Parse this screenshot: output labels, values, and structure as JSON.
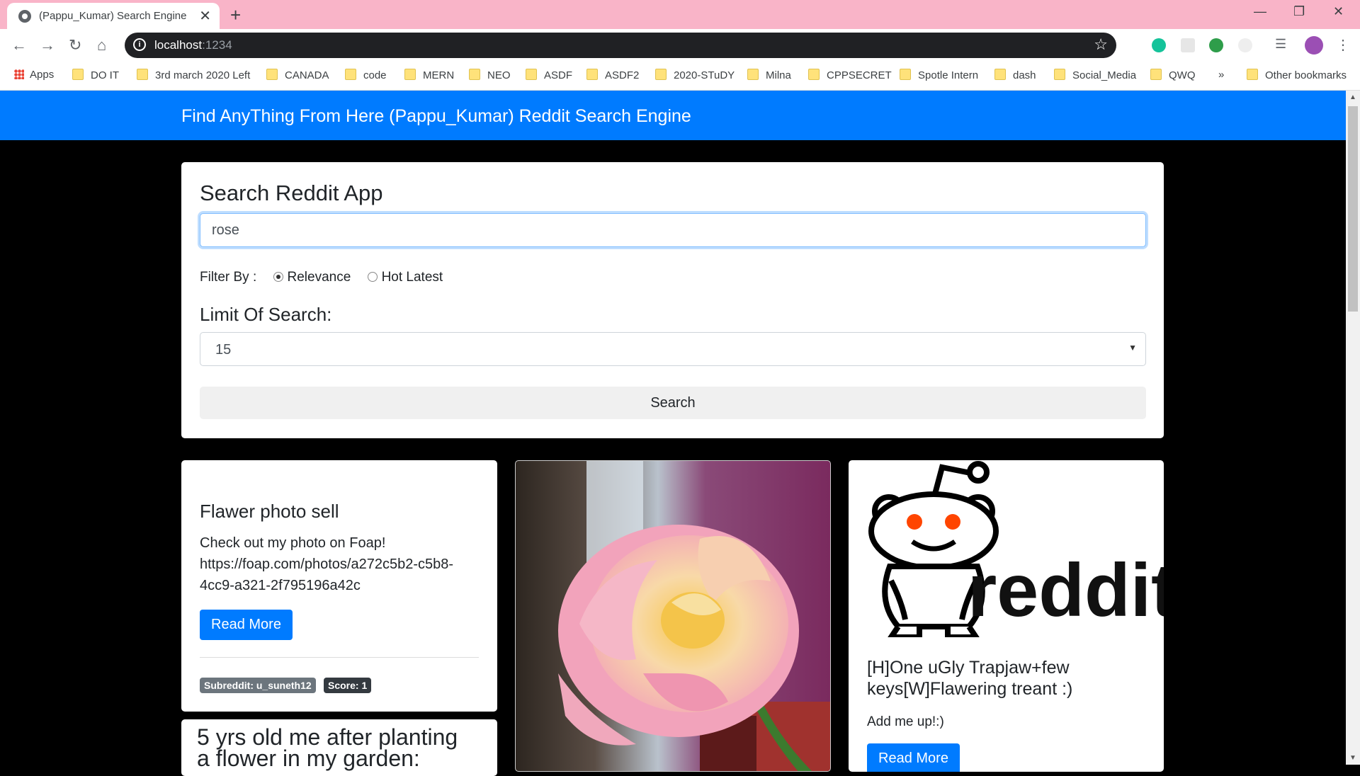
{
  "browser": {
    "tab_title": "(Pappu_Kumar) Search Engine",
    "url_host": "localhost",
    "url_port": ":1234"
  },
  "bookmarks": [
    {
      "label": "Apps",
      "icon": "apps-grid-icon"
    },
    {
      "label": "DO IT",
      "icon": "folder-icon"
    },
    {
      "label": "3rd march 2020 Left",
      "icon": "folder-icon"
    },
    {
      "label": "CANADA",
      "icon": "folder-icon"
    },
    {
      "label": "code",
      "icon": "folder-icon"
    },
    {
      "label": "MERN",
      "icon": "folder-icon"
    },
    {
      "label": "NEO",
      "icon": "folder-icon"
    },
    {
      "label": "ASDF",
      "icon": "folder-icon"
    },
    {
      "label": "ASDF2",
      "icon": "folder-icon"
    },
    {
      "label": "2020-STuDY",
      "icon": "folder-icon"
    },
    {
      "label": "Milna",
      "icon": "folder-icon"
    },
    {
      "label": "CPPSECRET",
      "icon": "folder-icon"
    },
    {
      "label": "Spotle Intern",
      "icon": "folder-icon"
    },
    {
      "label": "dash",
      "icon": "folder-icon"
    },
    {
      "label": "Social_Media",
      "icon": "folder-icon"
    },
    {
      "label": "QWQ",
      "icon": "folder-icon"
    }
  ],
  "bookmarks_more": "»",
  "other_bookmarks": "Other bookmarks",
  "navbar": {
    "brand": "Find AnyThing From Here (Pappu_Kumar) Reddit Search Engine"
  },
  "search": {
    "heading": "Search Reddit App",
    "query": "rose",
    "filter_label": "Filter By :",
    "filter_options": [
      "Relevance",
      "Hot Latest"
    ],
    "filter_selected": "Relevance",
    "limit_label": "Limit Of Search:",
    "limit_value": "15",
    "button_label": "Search"
  },
  "results": [
    {
      "title": "Flawer photo sell",
      "text_line1": "Check out my photo on Foap!",
      "text_line2": "https://foap.com/photos/a272c5b2-c5b8-",
      "text_line3": "4cc9-a321-2f795196a42c",
      "button": "Read More",
      "subreddit_badge": "Subreddit: u_suneth12",
      "score_badge": "Score: 1"
    },
    {
      "title_line1": "5 yrs old me after planting",
      "title_line2": "a flower in my garden:"
    },
    {
      "image": "pink-rose-photo"
    },
    {
      "logo_text": "reddit",
      "title_line1": "[H]One uGly Trapjaw+few",
      "title_line2": "keys[W]Flawering treant :)",
      "text": "Add me up!:)",
      "button": "Read More"
    }
  ],
  "colors": {
    "accent": "#007bff",
    "tabstrip": "#f9b4c8",
    "page_bg": "#000000"
  }
}
